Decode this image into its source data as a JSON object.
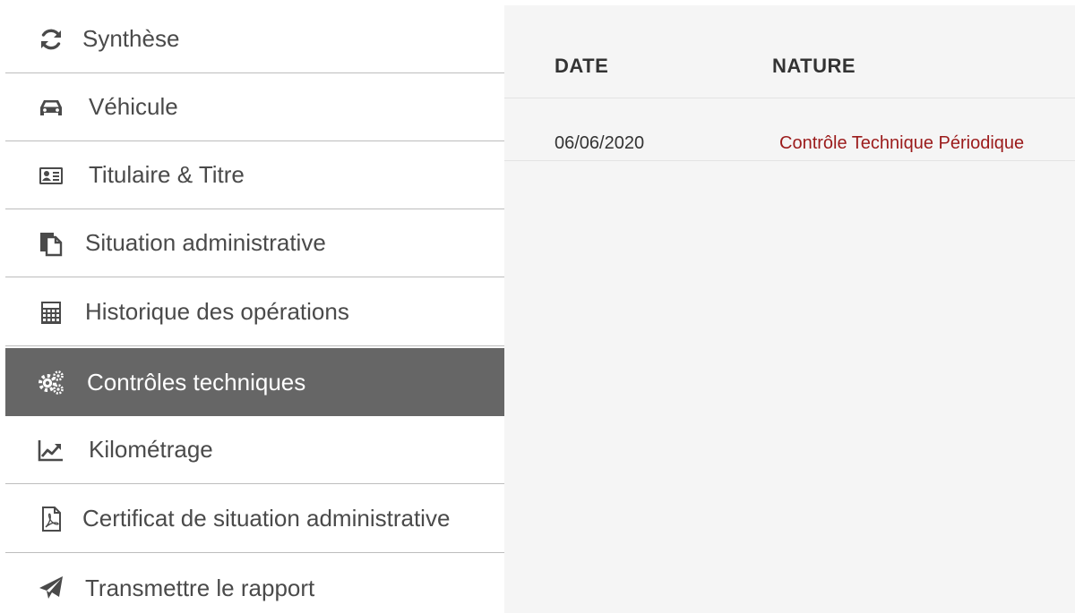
{
  "sidebar": {
    "items": [
      {
        "label": "Synthèse",
        "icon": "refresh-icon",
        "active": false
      },
      {
        "label": "Véhicule",
        "icon": "car-icon",
        "active": false
      },
      {
        "label": "Titulaire & Titre",
        "icon": "id-card-icon",
        "active": false
      },
      {
        "label": "Situation administrative",
        "icon": "documents-icon",
        "active": false
      },
      {
        "label": "Historique des opérations",
        "icon": "calculator-icon",
        "active": false
      },
      {
        "label": "Contrôles techniques",
        "icon": "gears-icon",
        "active": true
      },
      {
        "label": "Kilométrage",
        "icon": "line-chart-icon",
        "active": false
      },
      {
        "label": "Certificat de situation administrative",
        "icon": "pdf-file-icon",
        "active": false
      },
      {
        "label": "Transmettre le rapport",
        "icon": "paper-plane-icon",
        "active": false
      }
    ]
  },
  "main": {
    "columns": [
      "DATE",
      "NATURE"
    ],
    "rows": [
      {
        "date": "06/06/2020",
        "nature": "Contrôle Technique Périodique"
      }
    ]
  },
  "colors": {
    "active_bg": "#666666",
    "link_red": "#9b1b1b",
    "panel_bg": "#f5f5f5"
  }
}
